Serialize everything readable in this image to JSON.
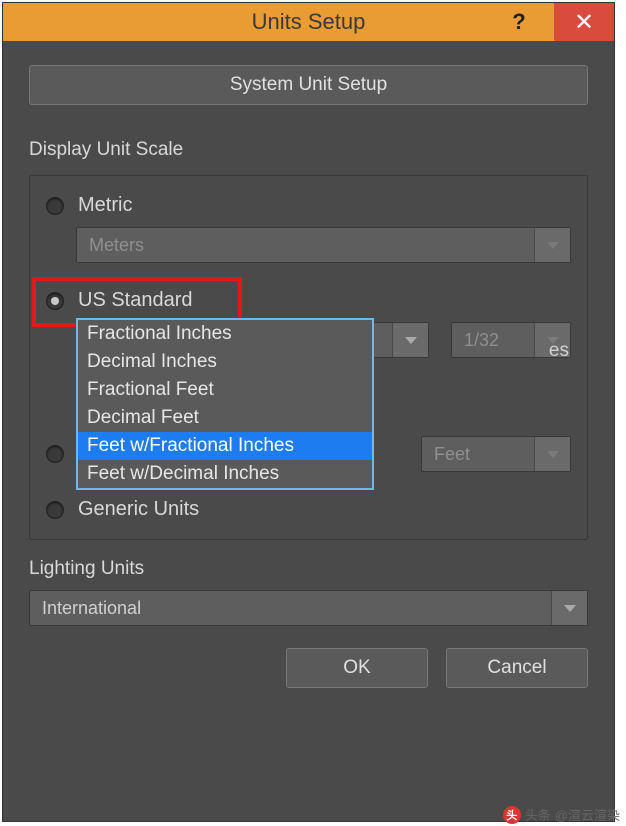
{
  "titlebar": {
    "title": "Units Setup",
    "help": "?",
    "close": "✕"
  },
  "system_button_label": "System Unit Setup",
  "display_scale": {
    "header": "Display Unit Scale",
    "metric": {
      "label": "Metric",
      "value": "Meters"
    },
    "us_standard": {
      "label": "US Standard",
      "dropdown_display": "Feet w/Fra…nal Inches",
      "fraction_value": "1/32",
      "options": [
        "Fractional Inches",
        "Decimal Inches",
        "Fractional Feet",
        "Decimal Feet",
        "Feet w/Fractional Inches",
        "Feet w/Decimal Inches"
      ],
      "selected_index": 4,
      "default_label_partial": "es",
      "default_value": "Feet"
    },
    "custom": {
      "label": ""
    },
    "generic": {
      "label": "Generic Units"
    }
  },
  "lighting": {
    "header": "Lighting Units",
    "value": "International"
  },
  "footer": {
    "ok": "OK",
    "cancel": "Cancel"
  },
  "watermark": {
    "prefix": "头条",
    "user": "@渲云渲染"
  }
}
